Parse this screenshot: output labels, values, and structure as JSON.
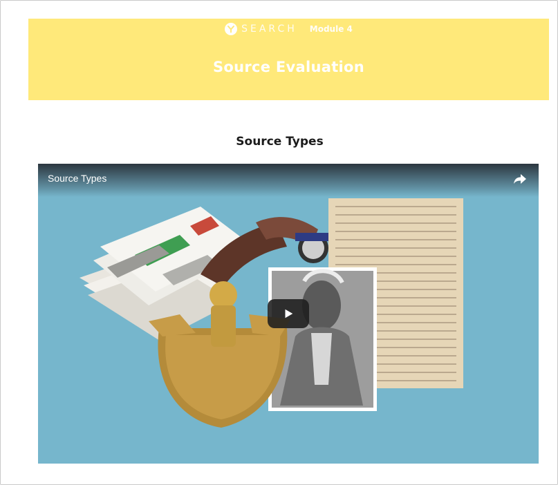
{
  "header": {
    "brand": "SEARCH",
    "module": "Module 4",
    "title": "Source Evaluation"
  },
  "section": {
    "title": "Source Types"
  },
  "video": {
    "title": "Source Types",
    "share_icon": "share-icon",
    "play_icon": "play-icon"
  },
  "colors": {
    "hero_bg": "#ffe97a",
    "video_bg": "#76b6cc",
    "title_text": "#1b1b1b"
  }
}
